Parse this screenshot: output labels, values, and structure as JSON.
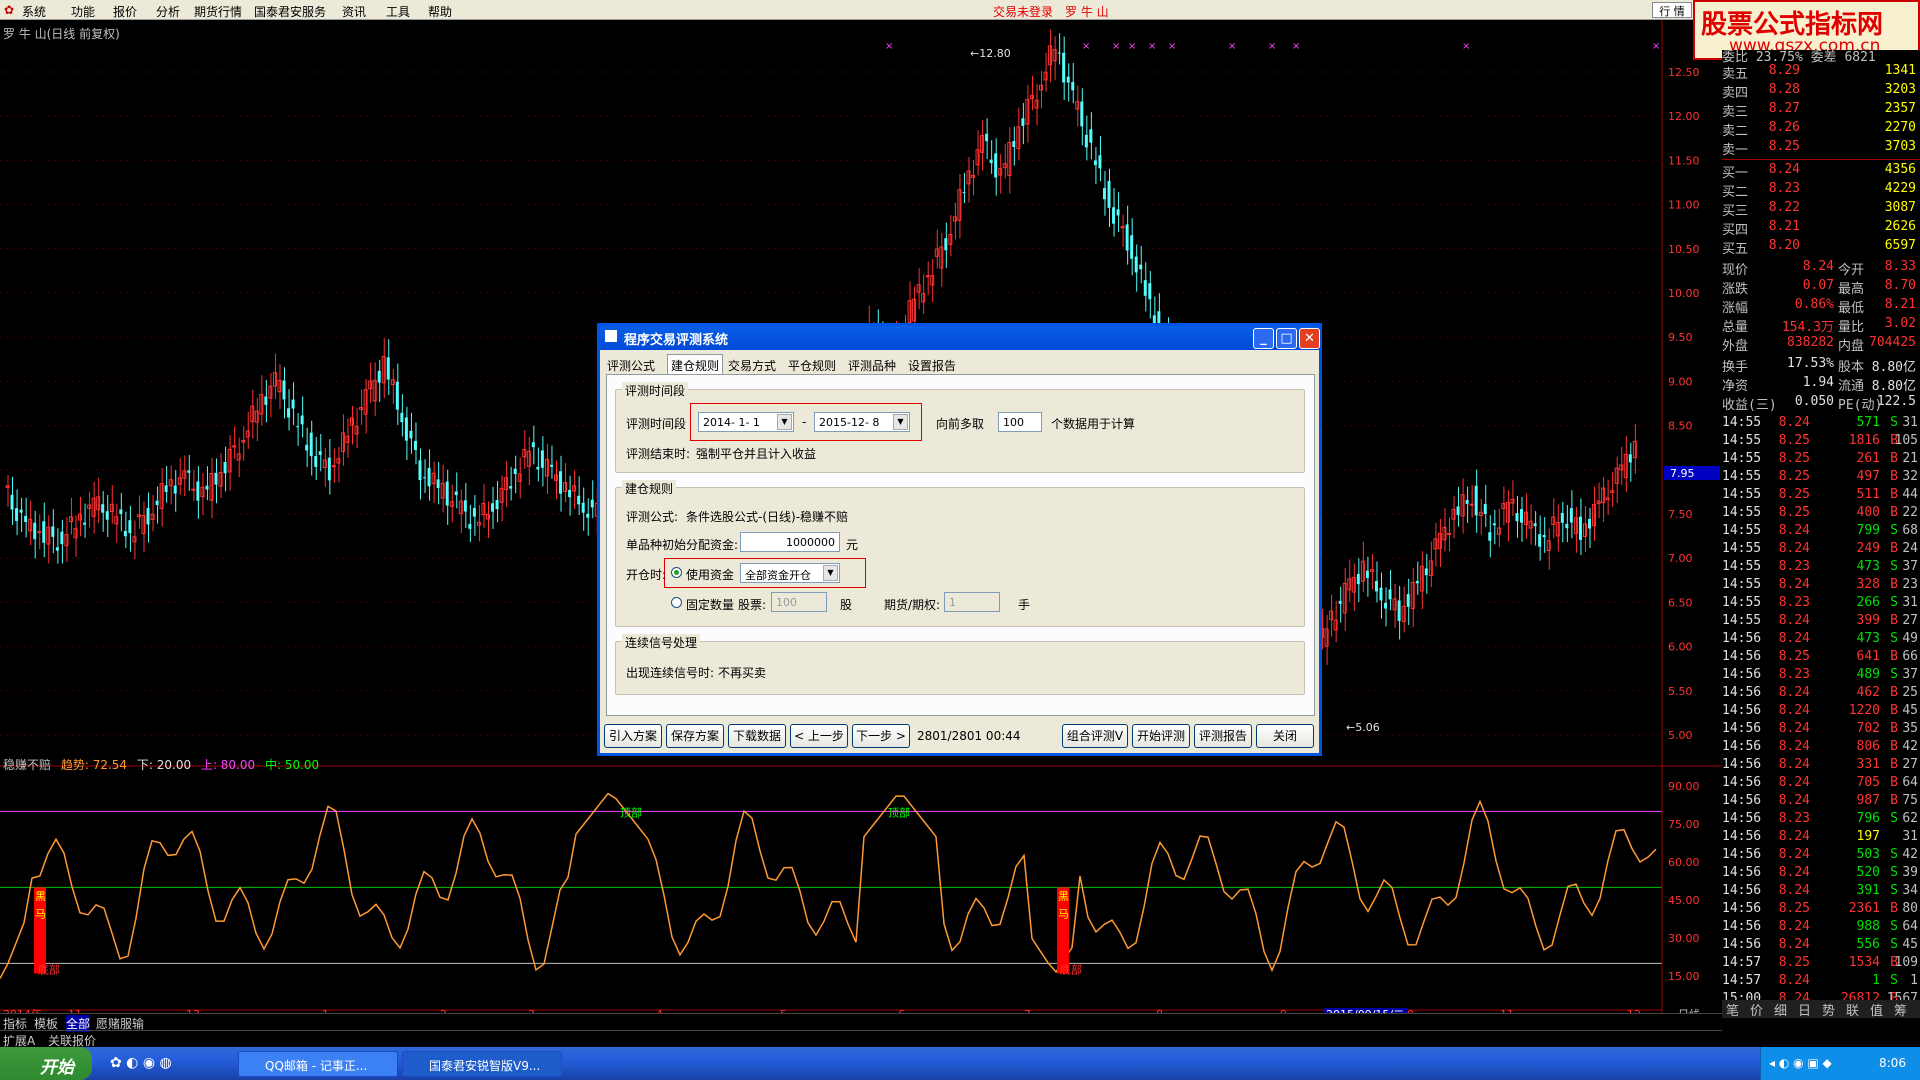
{
  "menubar": {
    "items": [
      "系统",
      "功能",
      "报价",
      "分析",
      "期货行情",
      "国泰君安服务",
      "资讯",
      "工具",
      "帮助"
    ],
    "login_status": "交易未登录",
    "stock_name": "罗 牛 山",
    "right_tab": "行 情"
  },
  "watermark": {
    "title": "股票公式指标网",
    "url": "www.gszx.com.cn"
  },
  "chart": {
    "title": "罗 牛 山(日线 前复权)",
    "high_label": "12.80",
    "low_label": "5.06",
    "current_price_tag": "7.95",
    "price_axis": [
      "12.50",
      "12.00",
      "11.50",
      "11.00",
      "10.50",
      "10.00",
      "9.50",
      "9.00",
      "8.50",
      "8.00",
      "7.50",
      "7.00",
      "6.50",
      "6.00",
      "5.50",
      "5.00"
    ]
  },
  "indicator": {
    "name": "稳赚不赔",
    "trend_label": "趋势: 72.54",
    "lower_label": "下: 20.00",
    "upper_label": "上: 80.00",
    "mid_label": "中: 50.00",
    "axis": [
      "90.00",
      "75.00",
      "60.00",
      "45.00",
      "30.00",
      "15.00"
    ],
    "top_marks": [
      "顶部",
      "顶部"
    ],
    "bottom_marks": [
      "底部",
      "底部"
    ],
    "buy_marks": [
      "黑马",
      "黑马"
    ]
  },
  "date_axis": {
    "labels": [
      "2014年",
      "11",
      "12",
      "1",
      "2",
      "3",
      "4",
      "5",
      "6",
      "7",
      "8",
      "9",
      "2015/09/15/二",
      "0",
      "11",
      "12"
    ],
    "period": "日线"
  },
  "bottom_tabs": [
    "指标",
    "模板",
    "全部",
    "愿赌服输"
  ],
  "bottom_tabs2": [
    "扩展A",
    "关联报价"
  ],
  "dialog": {
    "title": "程序交易评测系统",
    "tabs": [
      "评测公式",
      "建仓规则",
      "交易方式",
      "平仓规则",
      "评测品种",
      "设置报告"
    ],
    "group1": {
      "title": "评测时间段",
      "period_label": "评测时间段",
      "start_date": "2014- 1- 1",
      "separator": "-",
      "end_date": "2015-12- 8",
      "lookback_label": "向前多取",
      "lookback_value": "100",
      "lookback_suffix": "个数据用于计算",
      "end_label": "评测结束时:",
      "end_value": "强制平仓并且计入收益"
    },
    "group2": {
      "title": "建仓规则",
      "formula_label": "评测公式:",
      "formula_value": "条件选股公式-(日线)-稳赚不赔",
      "capital_label": "单品种初始分配资金:",
      "capital_value": "1000000",
      "capital_unit": "元",
      "open_label": "开仓时:",
      "use_capital": "使用资金",
      "capital_mode": "全部资金开仓",
      "fixed_qty": "固定数量",
      "stock_label": "股票:",
      "stock_value": "100",
      "stock_unit": "股",
      "futures_label": "期货/期权:",
      "futures_value": "1",
      "futures_unit": "手"
    },
    "group3": {
      "title": "连续信号处理",
      "signal_label": "出现连续信号时:",
      "signal_value": "不再买卖"
    },
    "buttons": {
      "import": "引入方案",
      "save": "保存方案",
      "download": "下载数据",
      "prev": "< 上一步",
      "next": "下一步 >",
      "progress": "2801/2801  00:44",
      "combo": "组合评测V",
      "start": "开始评测",
      "report": "评测报告",
      "close": "关闭"
    }
  },
  "quote": {
    "top_partial": "委比  23.75%  委差  6821",
    "sells": [
      {
        "label": "卖五",
        "price": "8.29",
        "vol": "1341"
      },
      {
        "label": "卖四",
        "price": "8.28",
        "vol": "3203"
      },
      {
        "label": "卖三",
        "price": "8.27",
        "vol": "2357"
      },
      {
        "label": "卖二",
        "price": "8.26",
        "vol": "2270"
      },
      {
        "label": "卖一",
        "price": "8.25",
        "vol": "3703"
      }
    ],
    "buys": [
      {
        "label": "买一",
        "price": "8.24",
        "vol": "4356"
      },
      {
        "label": "买二",
        "price": "8.23",
        "vol": "4229"
      },
      {
        "label": "买三",
        "price": "8.22",
        "vol": "3087"
      },
      {
        "label": "买四",
        "price": "8.21",
        "vol": "2626"
      },
      {
        "label": "买五",
        "price": "8.20",
        "vol": "6597"
      }
    ],
    "stats": [
      {
        "l1": "现价",
        "v1": "8.24",
        "l2": "今开",
        "v2": "8.33"
      },
      {
        "l1": "涨跌",
        "v1": "0.07",
        "l2": "最高",
        "v2": "8.70"
      },
      {
        "l1": "涨幅",
        "v1": "0.86%",
        "l2": "最低",
        "v2": "8.21"
      },
      {
        "l1": "总量",
        "v1": "154.3万",
        "l2": "量比",
        "v2": "3.02"
      },
      {
        "l1": "外盘",
        "v1": "838282",
        "l2": "内盘",
        "v2": "704425"
      }
    ],
    "stats2": [
      {
        "l1": "换手",
        "v1": "17.53%",
        "l2": "股本",
        "v2": "8.80亿"
      },
      {
        "l1": "净资",
        "v1": "1.94",
        "l2": "流通",
        "v2": "8.80亿"
      },
      {
        "l1": "收益(三)",
        "v1": "0.050",
        "l2": "PE(动)",
        "v2": "122.5"
      }
    ],
    "ticks": [
      {
        "t": "14:55",
        "p": "8.24",
        "v": "571",
        "d": "S",
        "n": "31"
      },
      {
        "t": "14:55",
        "p": "8.25",
        "v": "1816",
        "d": "B",
        "n": "105"
      },
      {
        "t": "14:55",
        "p": "8.25",
        "v": "261",
        "d": "B",
        "n": "21"
      },
      {
        "t": "14:55",
        "p": "8.25",
        "v": "497",
        "d": "B",
        "n": "32"
      },
      {
        "t": "14:55",
        "p": "8.25",
        "v": "511",
        "d": "B",
        "n": "44"
      },
      {
        "t": "14:55",
        "p": "8.25",
        "v": "400",
        "d": "B",
        "n": "22"
      },
      {
        "t": "14:55",
        "p": "8.24",
        "v": "799",
        "d": "S",
        "n": "68"
      },
      {
        "t": "14:55",
        "p": "8.24",
        "v": "249",
        "d": "B",
        "n": "24"
      },
      {
        "t": "14:55",
        "p": "8.23",
        "v": "473",
        "d": "S",
        "n": "37"
      },
      {
        "t": "14:55",
        "p": "8.24",
        "v": "328",
        "d": "B",
        "n": "23"
      },
      {
        "t": "14:55",
        "p": "8.23",
        "v": "266",
        "d": "S",
        "n": "31"
      },
      {
        "t": "14:55",
        "p": "8.24",
        "v": "399",
        "d": "B",
        "n": "27"
      },
      {
        "t": "14:56",
        "p": "8.24",
        "v": "473",
        "d": "S",
        "n": "49"
      },
      {
        "t": "14:56",
        "p": "8.25",
        "v": "641",
        "d": "B",
        "n": "66"
      },
      {
        "t": "14:56",
        "p": "8.23",
        "v": "489",
        "d": "S",
        "n": "37"
      },
      {
        "t": "14:56",
        "p": "8.24",
        "v": "462",
        "d": "B",
        "n": "25"
      },
      {
        "t": "14:56",
        "p": "8.24",
        "v": "1220",
        "d": "B",
        "n": "45"
      },
      {
        "t": "14:56",
        "p": "8.24",
        "v": "702",
        "d": "B",
        "n": "35"
      },
      {
        "t": "14:56",
        "p": "8.24",
        "v": "806",
        "d": "B",
        "n": "42"
      },
      {
        "t": "14:56",
        "p": "8.24",
        "v": "331",
        "d": "B",
        "n": "27"
      },
      {
        "t": "14:56",
        "p": "8.24",
        "v": "705",
        "d": "B",
        "n": "64"
      },
      {
        "t": "14:56",
        "p": "8.24",
        "v": "987",
        "d": "B",
        "n": "75"
      },
      {
        "t": "14:56",
        "p": "8.23",
        "v": "796",
        "d": "S",
        "n": "62"
      },
      {
        "t": "14:56",
        "p": "8.24",
        "v": "197",
        "d": "",
        "n": "31"
      },
      {
        "t": "14:56",
        "p": "8.24",
        "v": "503",
        "d": "S",
        "n": "42"
      },
      {
        "t": "14:56",
        "p": "8.24",
        "v": "520",
        "d": "S",
        "n": "39"
      },
      {
        "t": "14:56",
        "p": "8.24",
        "v": "391",
        "d": "S",
        "n": "34"
      },
      {
        "t": "14:56",
        "p": "8.25",
        "v": "2361",
        "d": "B",
        "n": "80"
      },
      {
        "t": "14:56",
        "p": "8.24",
        "v": "988",
        "d": "S",
        "n": "64"
      },
      {
        "t": "14:56",
        "p": "8.24",
        "v": "556",
        "d": "S",
        "n": "45"
      },
      {
        "t": "14:57",
        "p": "8.25",
        "v": "1534",
        "d": "B",
        "n": "109"
      },
      {
        "t": "14:57",
        "p": "8.24",
        "v": "1",
        "d": "S",
        "n": "1"
      },
      {
        "t": "15:00",
        "p": "8.24",
        "v": "26812",
        "d": "B",
        "n": "1567"
      }
    ],
    "bottom_tabs": [
      "笔",
      "价",
      "细",
      "日",
      "势",
      "联",
      "值",
      "筹"
    ]
  },
  "taskbar": {
    "start": "开始",
    "tasks": [
      "QQ邮箱 - 记事正...",
      "国泰君安锐智版V9..."
    ],
    "clock": "8:06"
  },
  "colors": {
    "up": "#ff3232",
    "down": "#54fcfc",
    "orange": "#ff9933",
    "dialog_blue": "#0054e3"
  }
}
